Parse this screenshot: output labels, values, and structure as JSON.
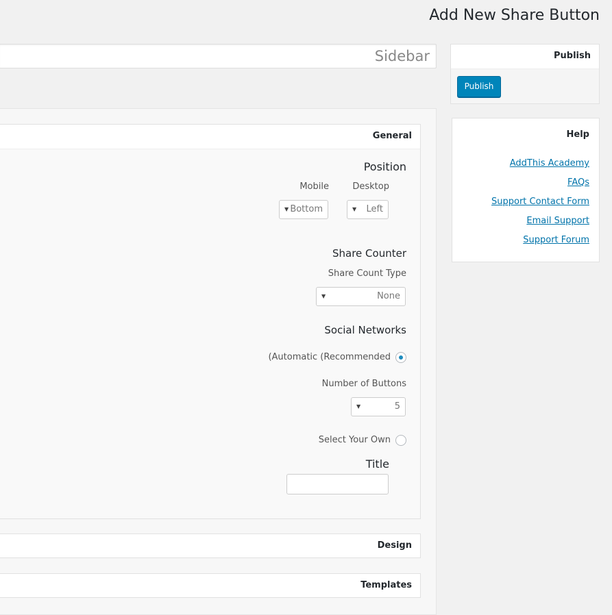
{
  "page": {
    "title": "Add New Share Button"
  },
  "title_field": {
    "value": "Sidebar"
  },
  "panels": {
    "general": {
      "label": "General",
      "position": {
        "heading": "Position",
        "mobile_label": "Mobile",
        "mobile_value": "Bottom",
        "desktop_label": "Desktop",
        "desktop_value": "Left"
      },
      "share_counter": {
        "heading": "Share Counter",
        "type_label": "Share Count Type",
        "type_value": "None"
      },
      "social_networks": {
        "heading": "Social Networks",
        "automatic_label": "(Automatic (Recommended",
        "automatic_selected": true,
        "number_label": "Number of Buttons",
        "number_value": "5",
        "select_own_label": "Select Your Own",
        "select_own_selected": false
      },
      "title": {
        "label": "Title",
        "value": ""
      }
    },
    "design": {
      "label": "Design"
    },
    "templates": {
      "label": "Templates"
    }
  },
  "publish": {
    "heading": "Publish",
    "button": "Publish",
    "accent": "#0085ba"
  },
  "help": {
    "heading": "Help",
    "links": [
      "AddThis Academy",
      "FAQs",
      "Support Contact Form",
      "Email Support",
      "Support Forum"
    ],
    "link_color": "#0073aa"
  }
}
